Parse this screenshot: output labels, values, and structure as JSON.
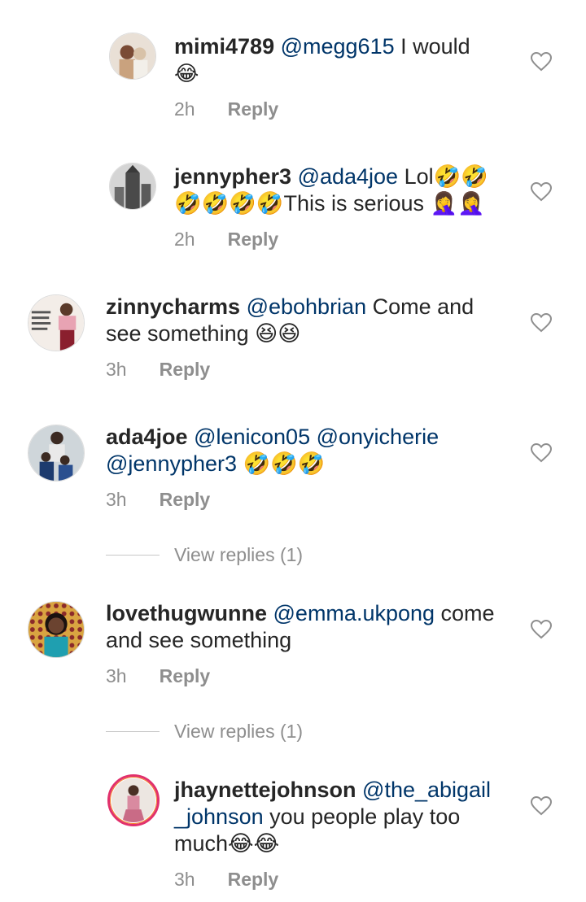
{
  "comments": [
    {
      "username": "mimi4789",
      "mention": "@megg615",
      "body": " I would",
      "body2": "😂",
      "time": "2h",
      "reply_label": "Reply",
      "avatar": "photo-of-two-people-avatar"
    },
    {
      "username": "jennypher3",
      "mention": "@ada4joe",
      "body": " Lol🤣🤣",
      "body2": "🤣🤣🤣🤣This is serious 🤦‍♀️🤦‍♀️",
      "time": "2h",
      "reply_label": "Reply",
      "avatar": "city-building-avatar"
    },
    {
      "username": "zinnycharms",
      "mention": "@ebohbrian",
      "body": " Come and",
      "body2": "see something 😆😆",
      "time": "3h",
      "reply_label": "Reply",
      "avatar": "woman-with-text-avatar"
    },
    {
      "username": "ada4joe",
      "mention": "@lenicon05",
      "mention2": "@onyicherie",
      "mention3": "@jennypher3",
      "body2": " 🤣🤣🤣",
      "time": "3h",
      "reply_label": "Reply",
      "avatar": "family-photo-avatar",
      "view_replies": "View replies (1)"
    },
    {
      "username": "lovethugwunne",
      "mention": "@emma.ukpong",
      "body": " come",
      "body2": "and see something",
      "time": "3h",
      "reply_label": "Reply",
      "avatar": "woman-portrait-avatar",
      "view_replies": "View replies (1)"
    },
    {
      "username": "jhaynettejohnson",
      "mention": "@the_abigail",
      "mention_cont": "_johnson",
      "body": " you people play too",
      "body2": "much😂😂",
      "time": "3h",
      "reply_label": "Reply",
      "avatar": "woman-in-dress-avatar"
    }
  ],
  "colors": {
    "text": "#262626",
    "mention": "#003569",
    "secondary": "#8e8e8e",
    "heart_outline": "#8e8e8e",
    "story_ring": "#e1306c"
  }
}
